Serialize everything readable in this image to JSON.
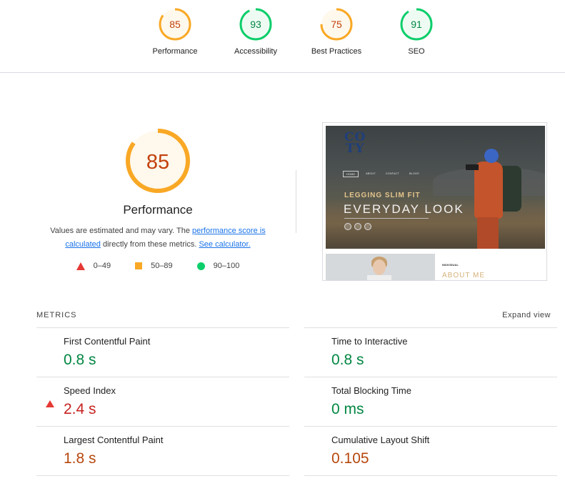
{
  "top_scores": [
    {
      "label": "Performance",
      "score": "85",
      "fraction": 0.85,
      "color": "#f9a825",
      "fill": "#fff8ec",
      "text_color": "#c2410c"
    },
    {
      "label": "Accessibility",
      "score": "93",
      "fraction": 0.93,
      "color": "#0cce6b",
      "fill": "#eefbf3",
      "text_color": "#018642"
    },
    {
      "label": "Best Practices",
      "score": "75",
      "fraction": 0.75,
      "color": "#f9a825",
      "fill": "#fff8ec",
      "text_color": "#c2410c"
    },
    {
      "label": "SEO",
      "score": "91",
      "fraction": 0.91,
      "color": "#0cce6b",
      "fill": "#eefbf3",
      "text_color": "#018642"
    }
  ],
  "performance": {
    "score": "85",
    "fraction": 0.85,
    "title": "Performance",
    "desc_prefix": "Values are estimated and may vary. The ",
    "link_score": "performance score is calculated",
    "desc_middle": " directly from these metrics. ",
    "link_calc": "See calculator."
  },
  "legend": [
    {
      "shape": "triangle",
      "range": "0–49"
    },
    {
      "shape": "square",
      "range": "50–89"
    },
    {
      "shape": "circle",
      "range": "90–100"
    }
  ],
  "screenshot": {
    "logo_line1": "CO",
    "logo_line2": "TY",
    "nav": [
      "HOME",
      "ABOUT",
      "CONTACT",
      "BLOGS"
    ],
    "subtitle": "LEGGING SLIM FIT",
    "headline": "EVERYDAY LOOK",
    "lower_small": "INDIVIDUAL",
    "lower_big": "ABOUT ME"
  },
  "metrics_section": {
    "title": "METRICS",
    "expand": "Expand view"
  },
  "metrics": [
    {
      "label": "First Contentful Paint",
      "value": "0.8 s",
      "status": "good"
    },
    {
      "label": "Time to Interactive",
      "value": "0.8 s",
      "status": "good"
    },
    {
      "label": "Speed Index",
      "value": "2.4 s",
      "status": "poor"
    },
    {
      "label": "Total Blocking Time",
      "value": "0 ms",
      "status": "good"
    },
    {
      "label": "Largest Contentful Paint",
      "value": "1.8 s",
      "status": "avg"
    },
    {
      "label": "Cumulative Layout Shift",
      "value": "0.105",
      "status": "avg"
    }
  ],
  "colors": {
    "good": "#0cce6b",
    "average": "#f9a825",
    "poor": "#e53935",
    "link": "#1a73e8"
  }
}
